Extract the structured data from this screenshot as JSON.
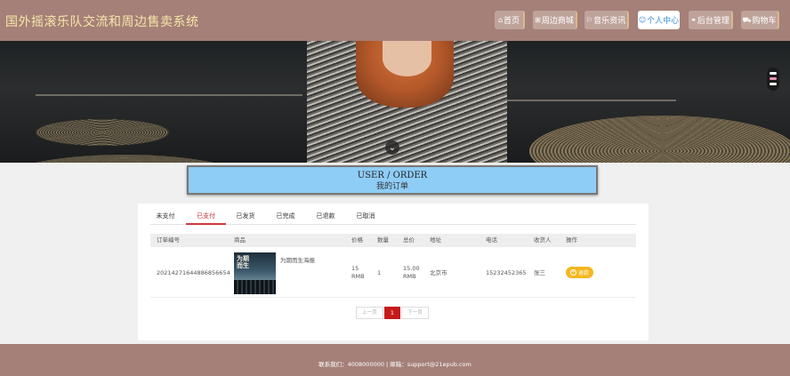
{
  "header": {
    "site_title": "国外摇滚乐队交流和周边售卖系统",
    "nav": [
      {
        "icon": "home-icon",
        "glyph": "⌂",
        "label": "首页"
      },
      {
        "icon": "grid-icon",
        "glyph": "⊞",
        "label": "周边商城"
      },
      {
        "icon": "flag-icon",
        "glyph": "⚐",
        "label": "音乐资讯"
      },
      {
        "icon": "user-icon",
        "glyph": "☺",
        "label": "个人中心"
      },
      {
        "icon": "link-icon",
        "glyph": "⚭",
        "label": "后台管理"
      },
      {
        "icon": "cart-icon",
        "glyph": "⛟",
        "label": "购物车"
      }
    ]
  },
  "banner": {
    "scroll_glyph": "⌄"
  },
  "title_box": {
    "en": "USER / ORDER",
    "cn": "我的订单"
  },
  "tabs": [
    "未支付",
    "已支付",
    "已发货",
    "已完成",
    "已退款",
    "已取消"
  ],
  "active_tab": "已支付",
  "table": {
    "headers": [
      "订单编号",
      "商品",
      "价格",
      "数量",
      "总价",
      "地址",
      "电话",
      "收货人",
      "操作"
    ],
    "rows": [
      {
        "order_no": "20214271644886856654",
        "product_image_text": "为期",
        "product_image_text2": "而生",
        "product": "为期而生海报",
        "price_line1": "15",
        "price_line2": "RMB",
        "quantity": "1",
        "total_line1": "15.00",
        "total_line2": "RMB",
        "address": "北京市",
        "phone": "15232452365",
        "receiver": "张三",
        "action": "退款"
      }
    ]
  },
  "pager": {
    "prev": "上一页",
    "current": "1",
    "next": "下一页"
  },
  "footer": {
    "text": "联系我们：4008000000 | 邮箱：support@21epub.com"
  },
  "colors": {
    "header_bg": "#a58078",
    "title_box_bg": "#8ecdf6",
    "active_tab": "#d23a3a",
    "refund_button": "#f4b81f",
    "pager_current": "#c61a1a"
  }
}
